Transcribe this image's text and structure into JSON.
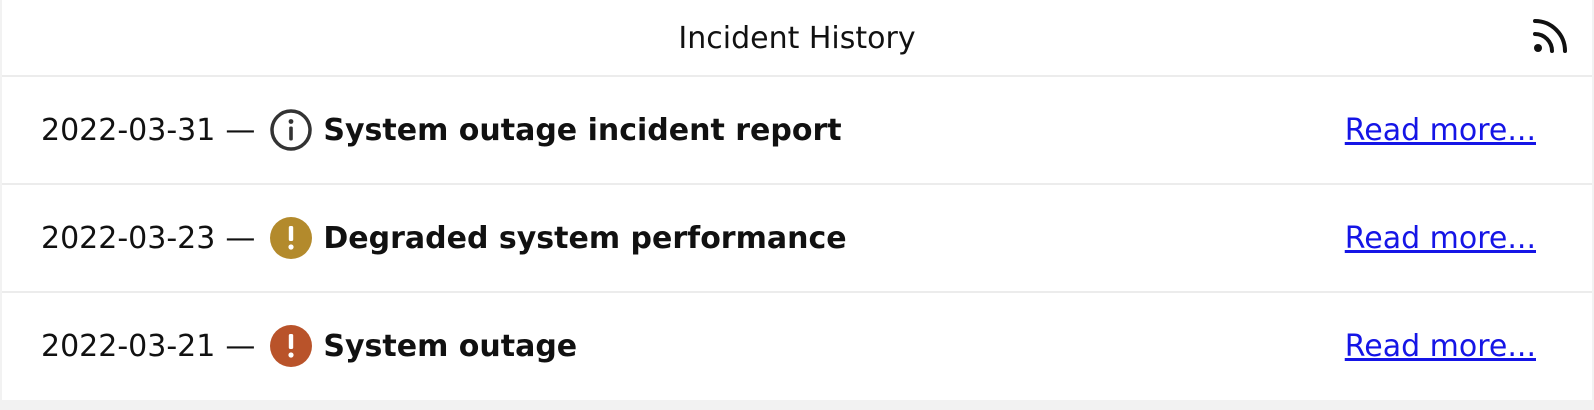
{
  "header": {
    "title": "Incident History",
    "feed_icon": "rss-icon"
  },
  "incidents": [
    {
      "date": "2022-03-31",
      "separator": "—",
      "status": "info",
      "status_icon": "info-icon",
      "status_color": "#333333",
      "title": "System outage incident report",
      "link": "Read more..."
    },
    {
      "date": "2022-03-23",
      "separator": "—",
      "status": "warning",
      "status_icon": "warning-icon",
      "status_color": "#b38a2c",
      "title": "Degraded system performance",
      "link": "Read more..."
    },
    {
      "date": "2022-03-21",
      "separator": "—",
      "status": "outage",
      "status_icon": "alert-icon",
      "status_color": "#b9532a",
      "title": "System outage",
      "link": "Read more..."
    }
  ],
  "colors": {
    "link": "#1515e6",
    "divider": "#ececec"
  }
}
